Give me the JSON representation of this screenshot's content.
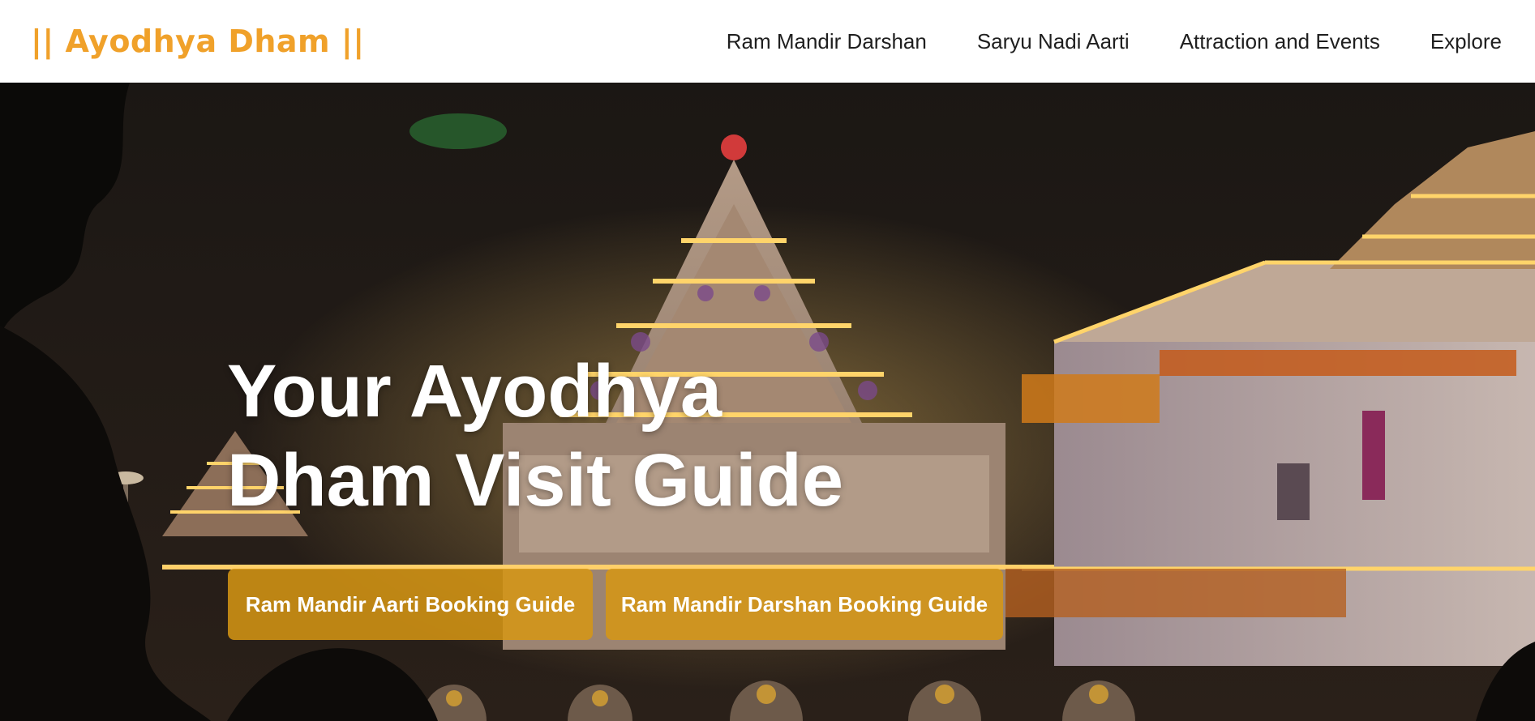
{
  "header": {
    "brand": "|| Ayodhya Dham ||",
    "nav": [
      {
        "label": "Ram Mandir Darshan"
      },
      {
        "label": "Saryu Nadi Aarti"
      },
      {
        "label": "Attraction and Events"
      },
      {
        "label": "Explore"
      }
    ]
  },
  "hero": {
    "title": "Your Ayodhya Dham Visit Guide",
    "image_icon": "temple-night-photo",
    "buttons": [
      {
        "label": "Ram Mandir Aarti Booking Guide"
      },
      {
        "label": "Ram Mandir Darshan Booking Guide"
      }
    ]
  },
  "colors": {
    "brand": "#f0a12a",
    "button": "#d6960f",
    "nav_text": "#1f1f1f"
  }
}
